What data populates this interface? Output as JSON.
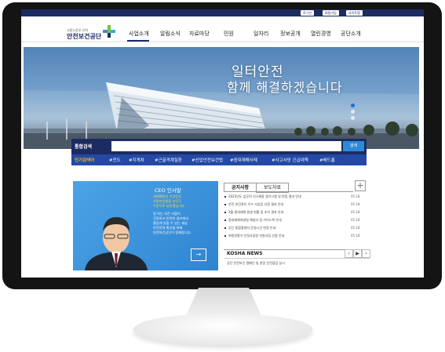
{
  "topbar": {
    "links": [
      "로그인",
      "회원가입",
      "사이트맵"
    ]
  },
  "header": {
    "logo_sub": "고용노동부 산하",
    "logo_main": "안전보건공단",
    "nav": [
      "사업소개",
      "알림소식",
      "자료마당",
      "민원",
      "일자리",
      "정보공개",
      "열린경영",
      "공단소개"
    ]
  },
  "banner": {
    "headline_1": "일터안전",
    "headline_2": "함께 해결하겠습니다"
  },
  "search": {
    "label": "통합검색",
    "placeholder": "",
    "button": "검색"
  },
  "tags": {
    "label": "인기검색어",
    "items": [
      "#전도",
      "#지게차",
      "#근골격계질환",
      "#산업안전보건법",
      "#중대재해사례",
      "#사고사망 긴급대책",
      "#배드롭"
    ]
  },
  "ceo": {
    "title": "CEO 인사말",
    "lines_yellow": [
      "재해예방과 건강증진",
      "사망만인율을 선진국",
      "수준으로 낮추겠습니다"
    ],
    "lines_white": [
      "일 하는 모든 사람이",
      "건강하고 안전한 일터에서",
      "즐겁게 일할 수 있는 세상",
      "안전문화 확산을 위해",
      "안전보건공단이 함께합니다."
    ],
    "arrow": "→"
  },
  "news": {
    "tabs": [
      "공지사항",
      "보도자료"
    ],
    "plus": "+",
    "items": [
      {
        "title": "2023년도 업무직 신규채용 필기시험 및 면접 결과 안내",
        "date": "05.18"
      },
      {
        "title": "안전 보건관리 우수 사업장 선정 결과 안내",
        "date": "05.18"
      },
      {
        "title": "3월 중대재해 발생 현황 및 조치 결과 안내",
        "date": "05.18"
      },
      {
        "title": "중대재해처벌법 해설서 및 가이드북 안내",
        "date": "05.18"
      },
      {
        "title": "공단 통합콜센터 운영시간 변경 안내",
        "date": "05.18"
      },
      {
        "title": "위험성평가 인정사업장 지원사업 신청 안내",
        "date": "05.18"
      }
    ]
  },
  "kosha_news": {
    "label": "KOSHA NEWS",
    "prev": "‹",
    "play": "▶",
    "next": "›",
    "text": "공단 안전보건 캠페인 및 현장 안전점검 실시"
  }
}
